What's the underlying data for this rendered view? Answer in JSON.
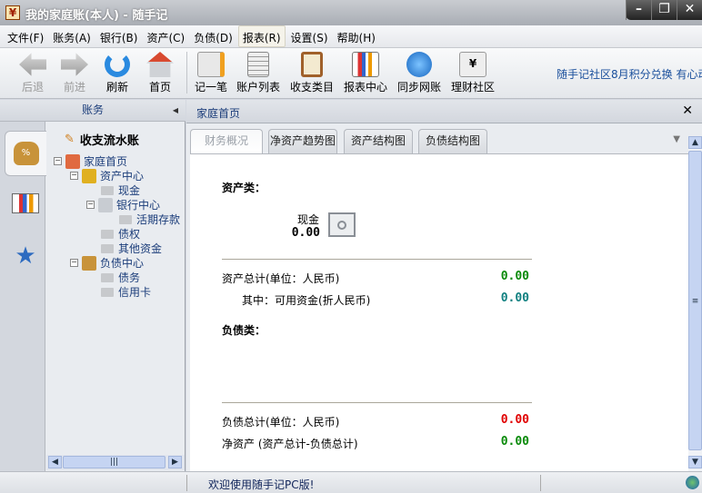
{
  "window": {
    "title": "我的家庭账(本人) - 随手记",
    "icon": "yen-icon",
    "controls": [
      "minimize",
      "restore",
      "close"
    ]
  },
  "menu": [
    {
      "label": "文件(F)"
    },
    {
      "label": "账务(A)"
    },
    {
      "label": "银行(B)"
    },
    {
      "label": "资产(C)"
    },
    {
      "label": "负债(D)"
    },
    {
      "label": "报表(R)",
      "active": true
    },
    {
      "label": "设置(S)"
    },
    {
      "label": "帮助(H)"
    }
  ],
  "toolbar": {
    "items": [
      {
        "label": "后退",
        "icon": "back-arrow-icon",
        "disabled": true
      },
      {
        "label": "前进",
        "icon": "forward-arrow-icon",
        "disabled": true
      },
      {
        "label": "刷新",
        "icon": "refresh-icon"
      },
      {
        "label": "首页",
        "icon": "home-icon"
      },
      {
        "label": "记一笔",
        "icon": "pencil-note-icon"
      },
      {
        "label": "账户列表",
        "icon": "account-list-icon"
      },
      {
        "label": "收支类目",
        "icon": "clipboard-icon"
      },
      {
        "label": "报表中心",
        "icon": "report-board-icon"
      },
      {
        "label": "同步网账",
        "icon": "satellite-icon"
      },
      {
        "label": "理财社区",
        "icon": "yen-chat-icon"
      }
    ],
    "promo": "随手记社区8月积分兑换  有心动"
  },
  "left_panel": {
    "title": "账务",
    "ledger_title": "收支流水账",
    "tree": [
      {
        "label": "家庭首页",
        "level": 0
      },
      {
        "label": "资产中心",
        "level": 1
      },
      {
        "label": "现金",
        "level": 2
      },
      {
        "label": "银行中心",
        "level": 2
      },
      {
        "label": "活期存款",
        "level": 3
      },
      {
        "label": "债权",
        "level": 2
      },
      {
        "label": "其他资金",
        "level": 2
      },
      {
        "label": "负债中心",
        "level": 1
      },
      {
        "label": "债务",
        "level": 2
      },
      {
        "label": "信用卡",
        "level": 2
      }
    ]
  },
  "right_panel": {
    "title": "家庭首页",
    "tabs": [
      "财务概况",
      "净资产趋势图",
      "资产结构图",
      "负债结构图"
    ],
    "active_tab": 0,
    "assets_heading": "资产类：",
    "cash_label": "现金",
    "cash_value": "0.00",
    "asset_total_label": "资产总计(单位：人民币)",
    "asset_total": "0.00",
    "available_label": "其中：可用资金(折人民币)",
    "available": "0.00",
    "liab_heading": "负债类：",
    "liab_total_label": "负债总计(单位：人民币)",
    "liab_total": "0.00",
    "net_label": "净资产 (资产总计-负债总计)",
    "net": "0.00",
    "colors": {
      "green": "#0a8a0a",
      "teal": "#118080",
      "red": "#e00000"
    }
  },
  "status": {
    "message": "欢迎使用随手记PC版!"
  }
}
